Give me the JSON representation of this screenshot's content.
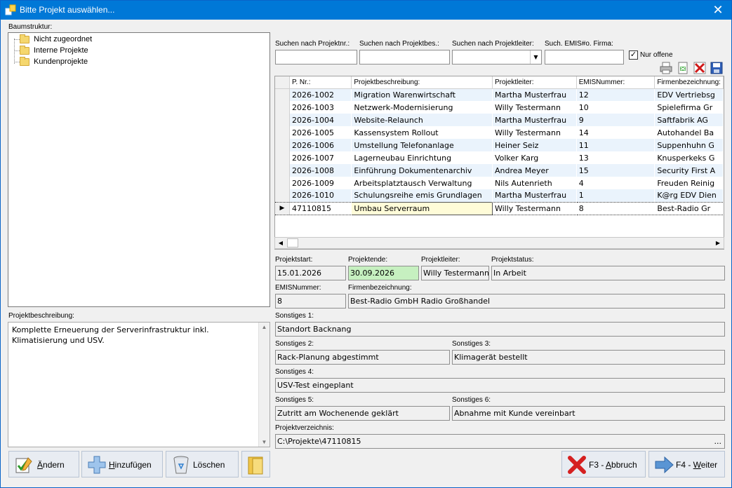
{
  "window": {
    "title": "Bitte Projekt auswählen...",
    "close": "✕"
  },
  "tree": {
    "label": "Baumstruktur:",
    "items": [
      "Nicht zugeordnet",
      "Interne Projekte",
      "Kundenprojekte"
    ]
  },
  "search": {
    "projnr_label": "Suchen nach Projektnr.:",
    "beschr_label": "Suchen nach Projektbes.:",
    "leiter_label": "Suchen nach Projektleiter:",
    "emis_label": "Such. EMIS#o. Firma:",
    "projnr_value": "",
    "beschr_value": "",
    "leiter_value": "",
    "emis_value": "",
    "nur_offene_label": "Nur offene",
    "nur_offene_checked": true
  },
  "toolbar_icons": [
    "printer-icon",
    "export-excel-icon",
    "delete-red-x-icon",
    "save-disk-icon"
  ],
  "grid": {
    "columns": [
      "P. Nr.:",
      "Projektbeschreibung:",
      "Projektleiter:",
      "EMISNummer:",
      "Firmenbezeichnung:"
    ],
    "rows": [
      [
        "2026-1002",
        "Migration Warenwirtschaft",
        "Martha Musterfrau",
        "12",
        "EDV Vertriebsg"
      ],
      [
        "2026-1003",
        "Netzwerk-Modernisierung",
        "Willy Testermann",
        "10",
        "Spielefirma Gr"
      ],
      [
        "2026-1004",
        "Website-Relaunch",
        "Martha Musterfrau",
        "9",
        "Saftfabrik AG"
      ],
      [
        "2026-1005",
        "Kassensystem Rollout",
        "Willy Testermann",
        "14",
        "Autohandel Ba"
      ],
      [
        "2026-1006",
        "Umstellung Telefonanlage",
        "Heiner Seiz",
        "11",
        "Suppenhuhn G"
      ],
      [
        "2026-1007",
        "Lagerneubau Einrichtung",
        "Volker Karg",
        "13",
        "Knusperkeks G"
      ],
      [
        "2026-1008",
        "Einführung Dokumentenarchiv",
        "Andrea Meyer",
        "15",
        "Security First A"
      ],
      [
        "2026-1009",
        "Arbeitsplatztausch Verwaltung",
        "Nils Autenrieth",
        "4",
        "Freuden Reinig"
      ],
      [
        "2026-1010",
        "Schulungsreihe emis Grundlagen",
        "Martha Musterfrau",
        "1",
        "K@rg EDV Dien"
      ],
      [
        "47110815",
        "Umbau Serverraum",
        "Willy Testermann",
        "8",
        "Best-Radio Gr"
      ]
    ],
    "selected_row": 9,
    "row_indicator": "▶"
  },
  "details": {
    "projektstart_label": "Projektstart:",
    "projektstart": "15.01.2026",
    "projektende_label": "Projektende:",
    "projektende": "30.09.2026",
    "projektleiter_label": "Projektleiter:",
    "projektleiter": "Willy Testermann",
    "projektstatus_label": "Projektstatus:",
    "projektstatus": "In Arbeit",
    "emis_label": "EMISNummer:",
    "emis": "8",
    "firma_label": "Firmenbezeichnung:",
    "firma": "Best-Radio GmbH Radio Großhandel",
    "sonstiges1_label": "Sonstiges 1:",
    "sonstiges1": "Standort Backnang",
    "sonstiges2_label": "Sonstiges 2:",
    "sonstiges2": "Rack-Planung abgestimmt",
    "sonstiges3_label": "Sonstiges 3:",
    "sonstiges3": "Klimagerät bestellt",
    "sonstiges4_label": "Sonstiges 4:",
    "sonstiges4": "USV-Test eingeplant",
    "sonstiges5_label": "Sonstiges 5:",
    "sonstiges5": "Zutritt am Wochenende geklärt",
    "sonstiges6_label": "Sonstiges 6:",
    "sonstiges6": "Abnahme mit Kunde vereinbart",
    "verzeichnis_label": "Projektverzeichnis:",
    "verzeichnis": "C:\\Projekte\\47110815",
    "browse": "..."
  },
  "beschreibung": {
    "label": "Projektbeschreibung:",
    "text": "Komplette Erneuerung der Serverinfrastruktur inkl. Klimatisierung und USV."
  },
  "buttons": {
    "aendern_key": "Ä",
    "aendern_rest": "ndern",
    "hinzu_key": "H",
    "hinzu_rest": "inzufügen",
    "loeschen": "Löschen",
    "abbruch_pre": "F3 - ",
    "abbruch_key": "A",
    "abbruch_rest": "bbruch",
    "weiter_pre": "F4 - ",
    "weiter_key": "W",
    "weiter_rest": "eiter"
  }
}
